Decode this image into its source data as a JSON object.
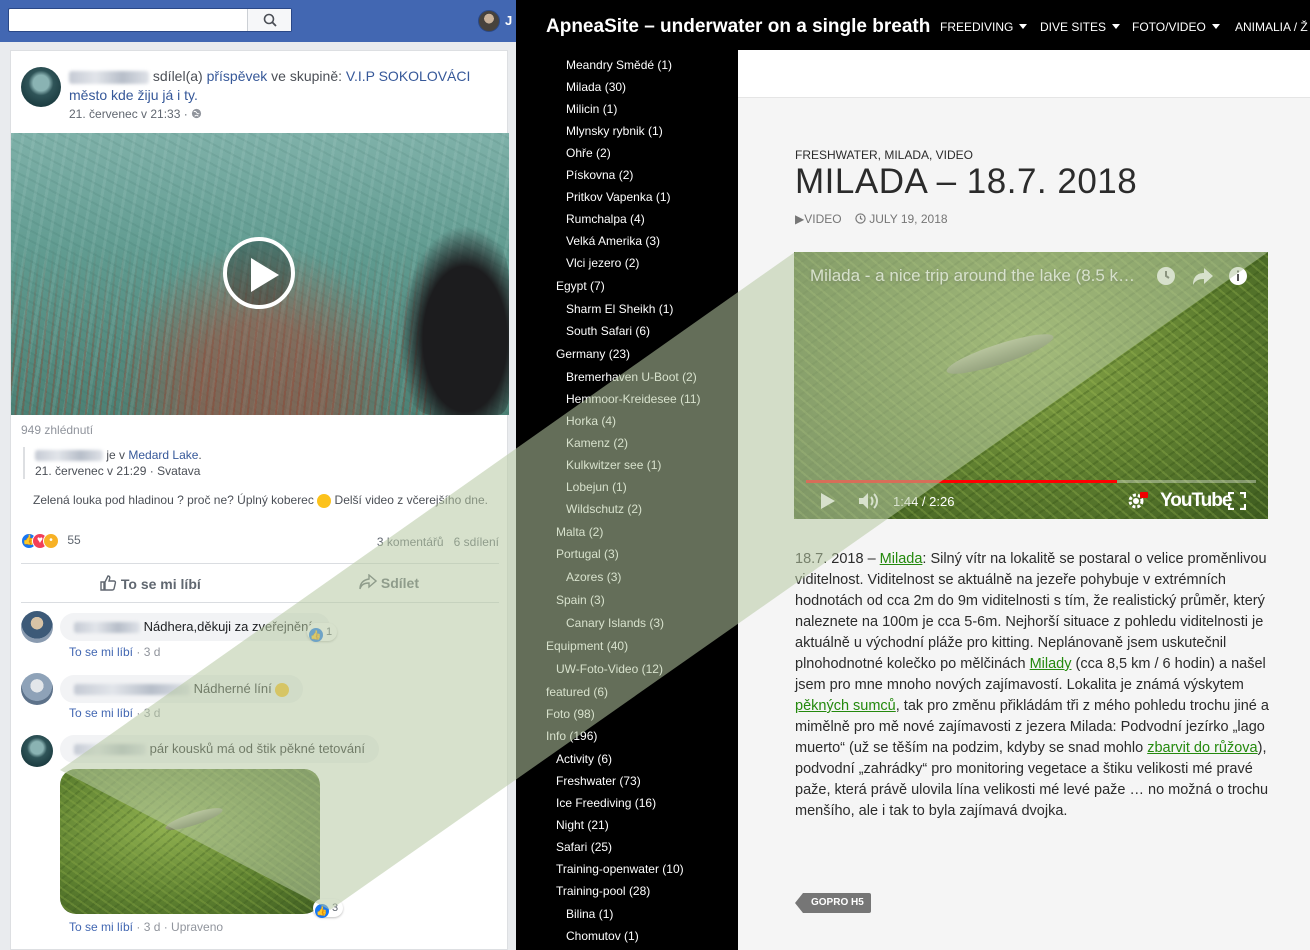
{
  "facebook": {
    "top_bar": {
      "search_placeholder": "",
      "user_short": "J"
    },
    "post": {
      "shared_text": "sdílel(a)",
      "post_word": "příspěvek",
      "in_group": "ve skupině:",
      "group_name": "V.I.P SOKOLOVÁCI město kde žiju já i ty.",
      "time": "21. červenec v 21:33 ·",
      "views": "949 zhlédnutí",
      "shared_location_prefix": "je v",
      "shared_location": "Medard Lake",
      "shared_time": "21. červenec v 21:29 · Svatava",
      "body": "Zelená louka pod hladinou ? proč ne? Úplný koberec",
      "body_suffix": "Delší video z včerejšího dne.",
      "reactions_count": "55",
      "comments_count": "3 komentářů",
      "shares_count": "6 sdílení",
      "like_label": "To se mi líbí",
      "share_label": "Sdílet"
    },
    "comments": [
      {
        "text": "Nádhera,děkuji za zveřejnění.",
        "like": "To se mi líbí",
        "age": "· 3 d",
        "likes": "1"
      },
      {
        "text": "Nádherné líní",
        "like": "To se mi líbí",
        "age": "· 3 d"
      },
      {
        "text": "pár kousků má od štik pěkné tetování",
        "like": "To se mi líbí",
        "age": "· 3 d · Upraveno",
        "likes": "3"
      }
    ]
  },
  "apnea": {
    "brand": "ApneaSite – underwater on a single breath",
    "menu": [
      "FREEDIVING",
      "DIVE SITES",
      "FOTO/VIDEO",
      "ANIMALIA / Ž"
    ],
    "sidebar": [
      {
        "label": "Meandry Smědé",
        "count": "(1)",
        "level": 2
      },
      {
        "label": "Milada",
        "count": "(30)",
        "level": 2
      },
      {
        "label": "Milicin",
        "count": "(1)",
        "level": 2
      },
      {
        "label": "Mlynsky rybnik",
        "count": "(1)",
        "level": 2
      },
      {
        "label": "Ohře",
        "count": "(2)",
        "level": 2
      },
      {
        "label": "Pískovna",
        "count": "(2)",
        "level": 2
      },
      {
        "label": "Pritkov Vapenka",
        "count": "(1)",
        "level": 2
      },
      {
        "label": "Rumchalpa",
        "count": "(4)",
        "level": 2
      },
      {
        "label": "Velká Amerika",
        "count": "(3)",
        "level": 2
      },
      {
        "label": "Vlci jezero",
        "count": "(2)",
        "level": 2
      },
      {
        "label": "Egypt",
        "count": "(7)",
        "level": 1
      },
      {
        "label": "Sharm El Sheikh",
        "count": "(1)",
        "level": 2
      },
      {
        "label": "South Safari",
        "count": "(6)",
        "level": 2
      },
      {
        "label": "Germany",
        "count": "(23)",
        "level": 1
      },
      {
        "label": "Bremerhaven U-Boot",
        "count": "(2)",
        "level": 2
      },
      {
        "label": "Hemmoor-Kreidesee",
        "count": "(11)",
        "level": 2
      },
      {
        "label": "Horka",
        "count": "(4)",
        "level": 2
      },
      {
        "label": "Kamenz",
        "count": "(2)",
        "level": 2
      },
      {
        "label": "Kulkwitzer see",
        "count": "(1)",
        "level": 2
      },
      {
        "label": "Lobejun",
        "count": "(1)",
        "level": 2
      },
      {
        "label": "Wildschutz",
        "count": "(2)",
        "level": 2
      },
      {
        "label": "Malta",
        "count": "(2)",
        "level": 1
      },
      {
        "label": "Portugal",
        "count": "(3)",
        "level": 1
      },
      {
        "label": "Azores",
        "count": "(3)",
        "level": 2
      },
      {
        "label": "Spain",
        "count": "(3)",
        "level": 1
      },
      {
        "label": "Canary Islands",
        "count": "(3)",
        "level": 2
      },
      {
        "label": "Equipment",
        "count": "(40)",
        "level": 0
      },
      {
        "label": "UW-Foto-Video",
        "count": "(12)",
        "level": 1
      },
      {
        "label": "featured",
        "count": "(6)",
        "level": 0
      },
      {
        "label": "Foto",
        "count": "(98)",
        "level": 0
      },
      {
        "label": "Info",
        "count": "(196)",
        "level": 0
      },
      {
        "label": "Activity",
        "count": "(6)",
        "level": 1
      },
      {
        "label": "Freshwater",
        "count": "(73)",
        "level": 1
      },
      {
        "label": "Ice Freediving",
        "count": "(16)",
        "level": 1
      },
      {
        "label": "Night",
        "count": "(21)",
        "level": 1
      },
      {
        "label": "Safari",
        "count": "(25)",
        "level": 1
      },
      {
        "label": "Training-openwater",
        "count": "(10)",
        "level": 1
      },
      {
        "label": "Training-pool",
        "count": "(28)",
        "level": 1
      },
      {
        "label": "Bilina",
        "count": "(1)",
        "level": 2
      },
      {
        "label": "Chomutov",
        "count": "(1)",
        "level": 2
      }
    ],
    "article": {
      "categories": "FRESHWATER, MILADA, VIDEO",
      "title": "MILADA – 18.7. 2018",
      "format": "VIDEO",
      "date": "JULY 19, 2018",
      "video_title": "Milada - a nice trip around the lake (8.5 k…",
      "video_time": "1:44 / 2:26",
      "video_progress": 0.69,
      "youtube": "YouTube",
      "p_date": "18.7. 2018 –",
      "p_link1": "Milada",
      "p1": ": Silný vítr na lokalitě se postaral o velice proměnlivou viditelnost. Viditelnost se aktuálně na jezeře pohybuje v extrémních hodnotách od cca 2m do 9m viditelnosti s tím, že realistický průměr, který naleznete na 100m je cca 5-6m. Nejhorší situace z pohledu viditelnosti je aktuálně u východní pláže pro kitting. Neplánovaně jsem uskutečnil plnohodnotné kolečko po mělčinách",
      "p_link2": "Milady",
      "p2": "(cca 8,5 km / 6 hodin) a našel jsem pro mne mnoho nových zajímavostí. Lokalita je známá výskytem",
      "p_link3": "pěkných sumců",
      "p3": ", tak pro změnu přikládám tři z mého pohledu trochu jiné a mimělně pro mě nové zajímavosti z jezera Milada: Podvodní jezírko „lago muerto“ (už se těším na podzim, kdyby se snad mohlo",
      "p_link4": "zbarvit do růžova",
      "p4": "), podvodní „zahrádky“ pro monitoring vegetace a štiku velikosti mé pravé paže, která právě ulovila lína velikosti mé levé paže … no možná o trochu menšího, ale i tak to byla zajímavá dvojka.",
      "tag": "GOPRO H5"
    }
  },
  "colors": {
    "fb_blue": "#4267b2",
    "fb_link": "#365899",
    "ap_green": "#24890d",
    "zoom_fill": "#b7c8a3"
  }
}
